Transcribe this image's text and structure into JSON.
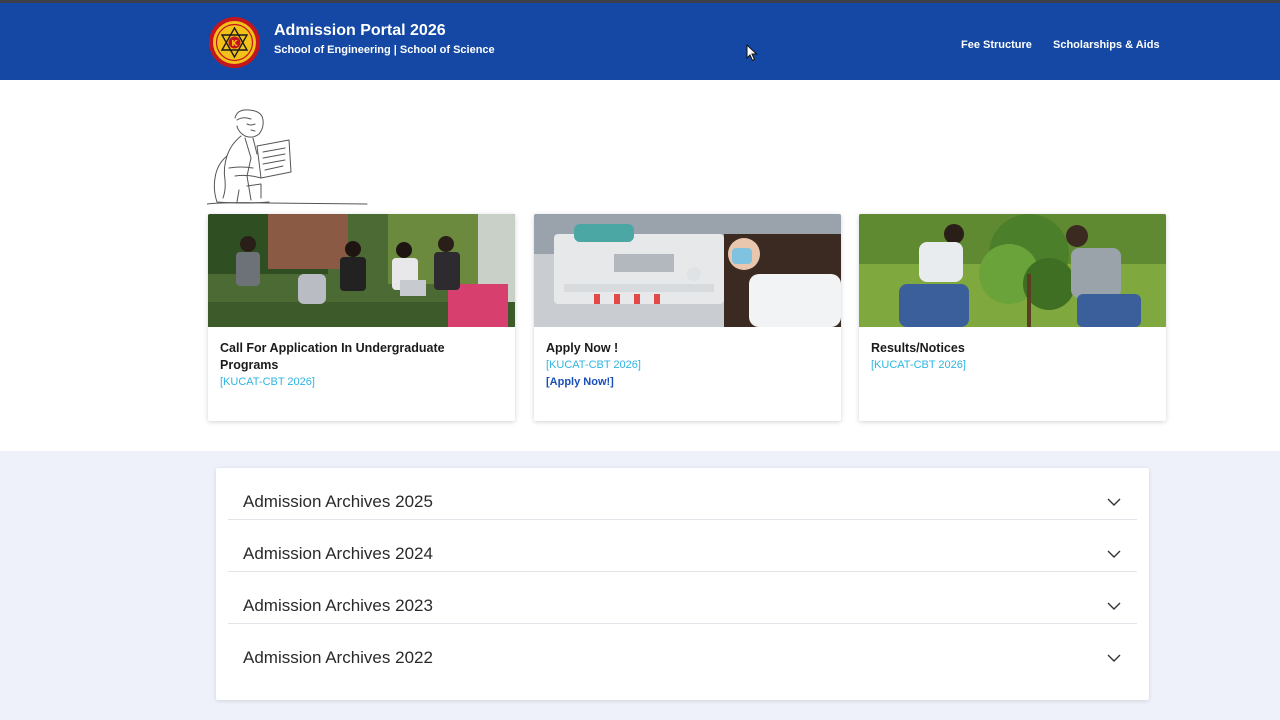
{
  "header": {
    "title": "Admission Portal 2026",
    "subtitle": "School of Engineering | School of Science",
    "logo_icon": "university-seal-icon",
    "nav": [
      {
        "label": "Fee Structure"
      },
      {
        "label": "Scholarships & Aids"
      }
    ]
  },
  "cards": [
    {
      "title": "Call For Application In Undergraduate Programs",
      "tag": "[KUCAT-CBT 2026]",
      "link": ""
    },
    {
      "title": "Apply Now !",
      "tag": "[KUCAT-CBT 2026]",
      "link": "[Apply Now!]"
    },
    {
      "title": "Results/Notices",
      "tag": "[KUCAT-CBT 2026]",
      "link": ""
    }
  ],
  "archives": [
    {
      "label": "Admission Archives 2025"
    },
    {
      "label": "Admission Archives 2024"
    },
    {
      "label": "Admission Archives 2023"
    },
    {
      "label": "Admission Archives 2022"
    }
  ],
  "colors": {
    "header_bg": "#1448a4",
    "tag": "#2fb5e3",
    "link": "#1a4fb8",
    "lower_bg": "#eef0fa"
  }
}
